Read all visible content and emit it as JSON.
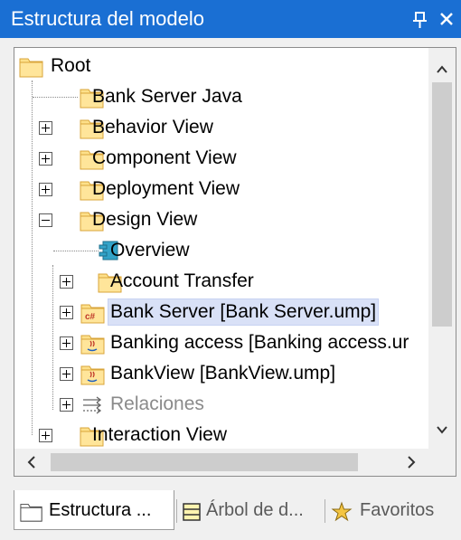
{
  "window": {
    "title": "Estructura del modelo",
    "pin_glyph": "📌",
    "close_glyph": "✕"
  },
  "tree": {
    "items": [
      {
        "label": "Root",
        "icon": "folder-icon",
        "expander": "none"
      },
      {
        "label": "Bank Server Java",
        "icon": "folder-icon",
        "expander": "none"
      },
      {
        "label": "Behavior View",
        "icon": "folder-icon",
        "expander": "plus"
      },
      {
        "label": "Component View",
        "icon": "folder-icon",
        "expander": "plus"
      },
      {
        "label": "Deployment View",
        "icon": "folder-icon",
        "expander": "plus"
      },
      {
        "label": "Design View",
        "icon": "folder-icon",
        "expander": "minus"
      },
      {
        "label": "Overview",
        "icon": "diagram-icon",
        "expander": "none"
      },
      {
        "label": "Account Transfer",
        "icon": "folder-icon",
        "expander": "plus"
      },
      {
        "label": "Bank Server [Bank Server.ump]",
        "icon": "csharp-package-icon",
        "expander": "plus",
        "selected": true
      },
      {
        "label": "Banking access [Banking access.ur",
        "icon": "java-package-icon",
        "expander": "plus"
      },
      {
        "label": "BankView [BankView.ump]",
        "icon": "java-package-icon",
        "expander": "plus"
      },
      {
        "label": "Relaciones",
        "icon": "relations-icon",
        "expander": "plus",
        "muted": true
      },
      {
        "label": "Interaction View",
        "icon": "folder-icon",
        "expander": "plus"
      }
    ]
  },
  "tabs": [
    {
      "label": "Estructura ...",
      "icon": "folder-icon",
      "active": true
    },
    {
      "label": "Árbol de d...",
      "icon": "diagram-tree-icon",
      "active": false
    },
    {
      "label": "Favoritos",
      "icon": "favorites-icon",
      "active": false
    }
  ],
  "colors": {
    "title_bar": "#1a6fd3",
    "folder": "#ffd966",
    "selection": "#d9e1f7"
  }
}
